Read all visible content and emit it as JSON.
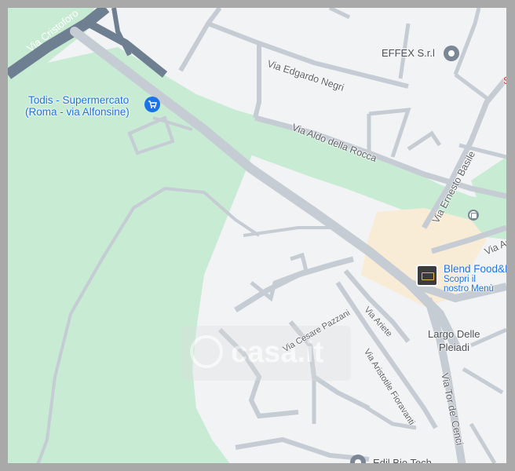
{
  "map": {
    "colors": {
      "land": "#f2f3f4",
      "park": "#c8ebd3",
      "park_light": "#d6f0de",
      "road": "#c5ccd3",
      "road_dark": "#9aa3ad",
      "highway": "#6f7f92",
      "commercial": "#f8ecd6",
      "poi_blue": "#1a73e8",
      "poi_grey": "#6b7280",
      "poi_food": "#3c3c3c",
      "red_text": "#e53935"
    },
    "streets": {
      "via_cristoforo": "Via Cristoforo",
      "via_edgardo_negri": "Via Edgardo Negri",
      "via_aldo_della_rocca": "Via Aldo della Rocca",
      "via_ernesto_basile": "Via Ernesto Basile",
      "via_as": "Via As",
      "via_cesare_pazzani": "Via Cesare Pazzani",
      "via_ariete": "Via Ariete",
      "via_aristotile_fioravanti": "Via Aristotile Fioravanti",
      "via_tor_de_cenci": "Via Tor de' Cenci"
    },
    "places": {
      "todis_line1": "Todis - Supermercato",
      "todis_line2": "(Roma - via Alfonsine)",
      "effex": "EFFEX S.r.l",
      "blend": "Blend Food&D",
      "blend_sub1": "Scopri il",
      "blend_sub2": "nostro Menù",
      "largo_line1": "Largo Delle",
      "largo_line2": "Pleiadi",
      "edil": "Edil Bio Tech",
      "red_partial": "St"
    },
    "icons": {
      "todis": "shopping-cart-icon",
      "effex": "location-pin-icon",
      "edil": "location-pin-icon",
      "blend": "restaurant-icon",
      "bus": "bus-stop-icon"
    },
    "watermark": "casa.it"
  }
}
